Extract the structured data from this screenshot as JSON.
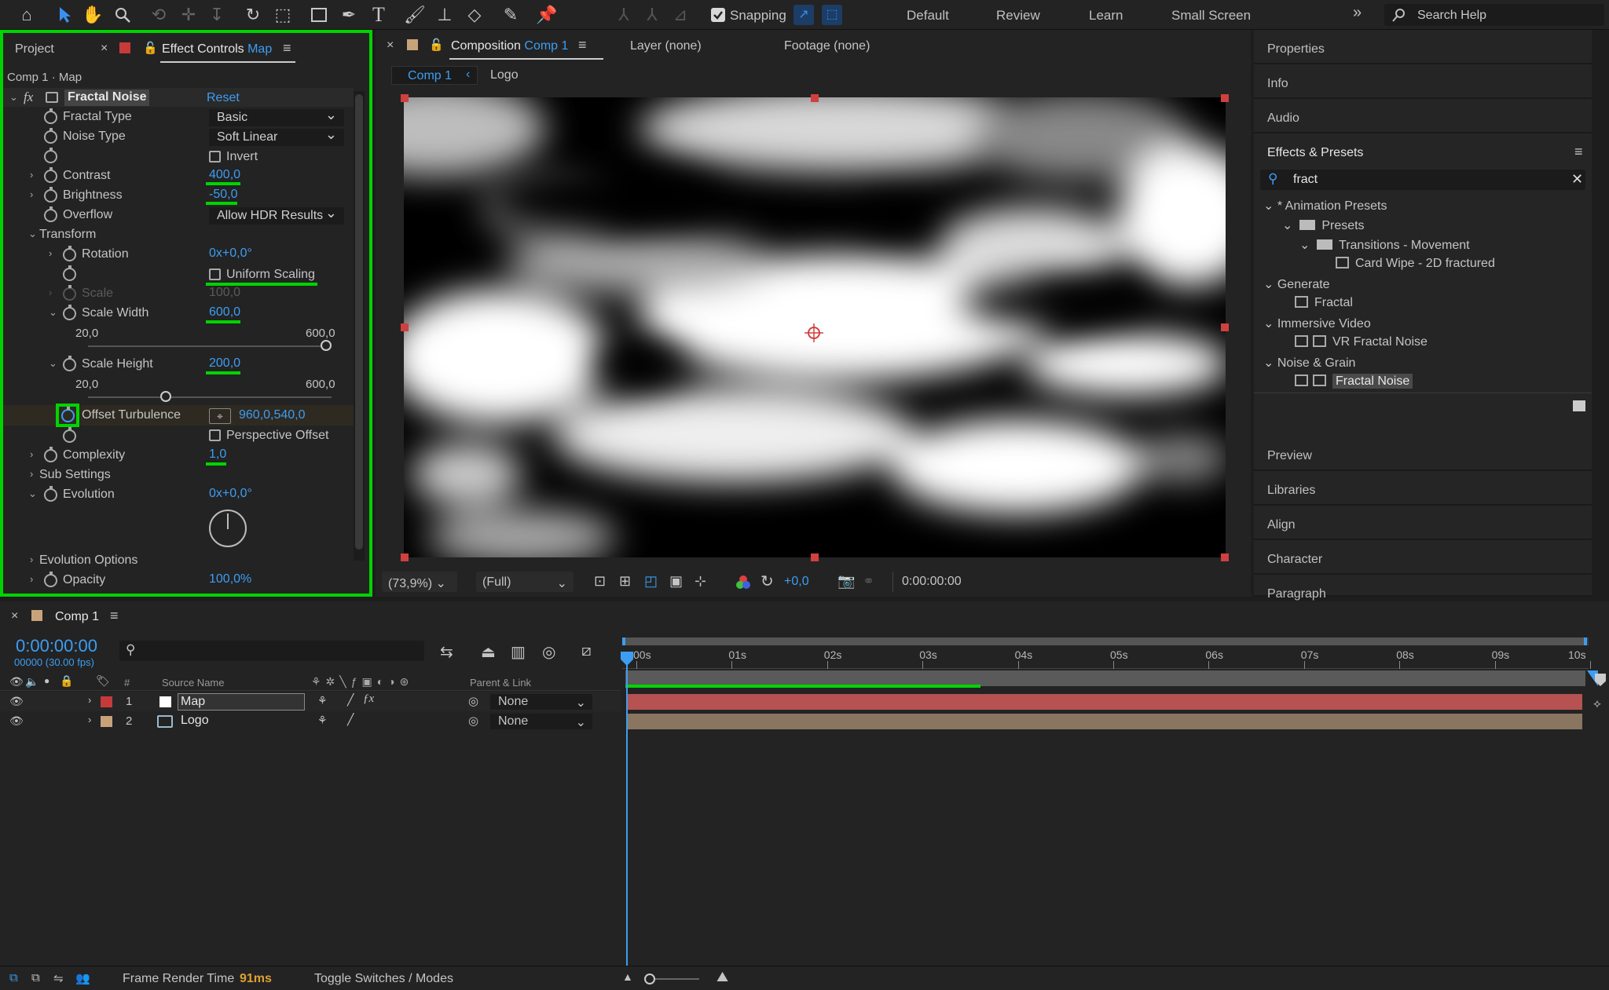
{
  "toolbar": {
    "snapping_label": "Snapping",
    "workspaces": [
      "Default",
      "Review",
      "Learn",
      "Small Screen"
    ],
    "search_placeholder": "Search Help"
  },
  "effect_controls": {
    "tab_project": "Project",
    "tab_title": "Effect Controls",
    "tab_layer": "Map",
    "breadcrumb": "Comp 1 · Map",
    "effect_name": "Fractal Noise",
    "reset_label": "Reset",
    "props": {
      "fractal_type_label": "Fractal Type",
      "fractal_type_value": "Basic",
      "noise_type_label": "Noise Type",
      "noise_type_value": "Soft Linear",
      "invert_label": "Invert",
      "contrast_label": "Contrast",
      "contrast_value": "400,0",
      "brightness_label": "Brightness",
      "brightness_value": "-50,0",
      "overflow_label": "Overflow",
      "overflow_value": "Allow HDR Results",
      "transform_label": "Transform",
      "rotation_label": "Rotation",
      "rotation_value": "0x+0,0°",
      "uniform_scaling_label": "Uniform Scaling",
      "scale_label": "Scale",
      "scale_value": "100,0",
      "scale_width_label": "Scale Width",
      "scale_width_value": "600,0",
      "scale_width_min": "20,0",
      "scale_width_max": "600,0",
      "scale_width_level": 1.0,
      "scale_height_label": "Scale Height",
      "scale_height_value": "200,0",
      "scale_height_min": "20,0",
      "scale_height_max": "600,0",
      "scale_height_level": 0.31,
      "offset_label": "Offset Turbulence",
      "offset_value": "960,0,540,0",
      "perspective_label": "Perspective Offset",
      "complexity_label": "Complexity",
      "complexity_value": "1,0",
      "sub_settings_label": "Sub Settings",
      "evolution_label": "Evolution",
      "evolution_value": "0x+0,0°",
      "evolution_options_label": "Evolution Options",
      "opacity_label": "Opacity",
      "opacity_value": "100,0%"
    }
  },
  "composition": {
    "tab_title": "Composition",
    "tab_comp": "Comp 1",
    "layer_tab": "Layer (none)",
    "footage_tab": "Footage (none)",
    "flow_comp": "Comp 1",
    "flow_layer": "Logo",
    "zoom": "(73,9%)",
    "resolution": "(Full)",
    "exposure": "+0,0",
    "timecode": "0:00:00:00"
  },
  "side_panels": {
    "top": [
      "Properties",
      "Info",
      "Audio"
    ],
    "effects_title": "Effects & Presets",
    "search_value": "fract",
    "tree": {
      "animation_presets": "* Animation Presets",
      "presets": "Presets",
      "transitions": "Transitions - Movement",
      "card_wipe": "Card Wipe - 2D fractured",
      "generate": "Generate",
      "fractal": "Fractal",
      "immersive": "Immersive Video",
      "vr_fractal": "VR Fractal Noise",
      "noise_grain": "Noise & Grain",
      "fractal_noise": "Fractal Noise"
    },
    "bottom": [
      "Preview",
      "Libraries",
      "Align",
      "Character",
      "Paragraph"
    ]
  },
  "timeline": {
    "tab_title": "Comp 1",
    "timecode": "0:00:00:00",
    "frames": "00000 (30.00 fps)",
    "col_source": "Source Name",
    "col_hash": "#",
    "col_parent": "Parent & Link",
    "ruler": [
      "00s",
      "01s",
      "02s",
      "03s",
      "04s",
      "05s",
      "06s",
      "07s",
      "08s",
      "09s",
      "10s"
    ],
    "layers": [
      {
        "num": "1",
        "name": "Map",
        "parent": "None",
        "label_color": "#c83a3a"
      },
      {
        "num": "2",
        "name": "Logo",
        "parent": "None",
        "label_color": "#c8a37a"
      }
    ]
  },
  "status": {
    "render_label": "Frame Render Time",
    "render_value": "91ms",
    "toggle_label": "Toggle Switches / Modes"
  }
}
